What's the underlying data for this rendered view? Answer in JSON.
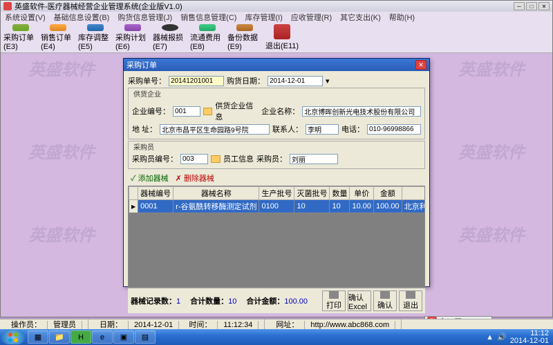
{
  "app": {
    "title": "英盛软件-医疗器械经营企业管理系统(企业版V1.0)",
    "menu": [
      "系统设置(V)",
      "基础信息设置(B)",
      "购货信息管理(J)",
      "销售信息管理(C)",
      "库存管理(I)",
      "应收管理(R)",
      "其它支出(K)",
      "帮助(H)"
    ],
    "toolbar": [
      {
        "label": "采购订单(E3)",
        "cls": "book"
      },
      {
        "label": "销售订单(E4)",
        "cls": "note"
      },
      {
        "label": "库存调整(E5)",
        "cls": "file"
      },
      {
        "label": "采购计划(E6)",
        "cls": "plan"
      },
      {
        "label": "器械报损(E7)",
        "cls": "cam"
      },
      {
        "label": "流通费用(E8)",
        "cls": "trans"
      },
      {
        "label": "备份数据(E9)",
        "cls": "back"
      },
      {
        "label": "退出(E11)",
        "cls": "exit"
      }
    ],
    "watermark": "英盛软件"
  },
  "dialog": {
    "title": "采购订单",
    "order_no_label": "采购单号：",
    "order_no": "20141201001",
    "date_label": "购货日期：",
    "date": "2014-12-01",
    "supplier_legend": "供货企业",
    "company_code_label": "企业编号：",
    "company_code": "001",
    "company_info_btn": "供货企业信息",
    "company_name_label": "企业名称：",
    "company_name": "北京博晖创新光电技术股份有限公司",
    "address_label": "地    址：",
    "address": "北京市昌平区生命园路9号院",
    "contact_label": "联系人：",
    "contact": "李明",
    "phone_label": "电话：",
    "phone": "010-96998866",
    "buyer_legend": "采购员",
    "buyer_code_label": "采购员编号：",
    "buyer_code": "003",
    "buyer_info_btn": "员工信息",
    "buyer_name_label": "采购员：",
    "buyer_name": "刘丽",
    "add_device": "✓ 添加器械",
    "del_device": "✗ 删除器械",
    "columns": [
      "",
      "器械编号",
      "器械名称",
      "生产批号",
      "灭菌批号",
      "数量",
      "单价",
      "金额",
      ""
    ],
    "row": [
      "",
      "0001",
      "r-谷氨酰转移酶测定试剂",
      "0100",
      "10",
      "10",
      "10.00",
      "100.00",
      "北京利德曼"
    ],
    "summary_count_label": "器械记录数：",
    "summary_count": "1",
    "summary_qty_label": "合计数量：",
    "summary_qty": "10",
    "summary_amt_label": "合计金额：",
    "summary_amt": "100.00",
    "btns": [
      "打印",
      "确认Excel",
      "确认",
      "退出"
    ]
  },
  "status": {
    "operator_label": "操作员：",
    "operator": "管理员",
    "date_label": "日期：",
    "date": "2014-12-01",
    "time_label": "时间：",
    "time": "11:12:34",
    "url_label": "网址：",
    "url": "http://www.abc868.com"
  },
  "ime": {
    "s": "S",
    "text": "中 ♪ ▦ ✎ ⌨ ▾"
  },
  "tray": {
    "time": "11:12",
    "date": "2014-12-01"
  }
}
